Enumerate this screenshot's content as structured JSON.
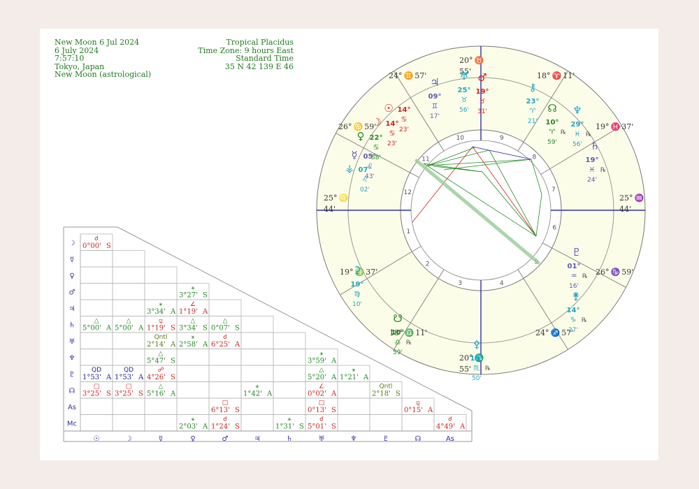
{
  "header": {
    "left": [
      "New Moon 6 Jul 2024",
      "6 July 2024",
      "7:57:10",
      "Tokyo, Japan",
      "New Moon (astrological)"
    ],
    "right": [
      "Tropical Placidus",
      "Time Zone: 9 hours East",
      "Standard Time",
      "35 N 42    139 E 46"
    ]
  },
  "colors": {
    "paper": "#ffffff",
    "background": "#f3ece8",
    "wheel_fill": "#fcfde9",
    "fire": "#d42020",
    "earth": "#208a20",
    "air": "#5a5ab8",
    "water": "#18a8c8",
    "aspect_red": "#cc2222",
    "aspect_green": "#208a20",
    "aspect_blue": "#2020a0",
    "axis_blue": "#3030a0"
  },
  "wheel": {
    "cusps": [
      {
        "house": 1,
        "deg": "25°",
        "sign": "♌",
        "min": "44'"
      },
      {
        "house": 2,
        "deg": "19°",
        "sign": "♍",
        "min": "37'"
      },
      {
        "house": 3,
        "deg": "18°",
        "sign": "♎",
        "min": "11'"
      },
      {
        "house": 4,
        "deg": "20°",
        "sign": "♏",
        "min": "55'"
      },
      {
        "house": 5,
        "deg": "24°",
        "sign": "♐",
        "min": "57'"
      },
      {
        "house": 6,
        "deg": "26°",
        "sign": "♑",
        "min": "59'"
      },
      {
        "house": 7,
        "deg": "25°",
        "sign": "♒",
        "min": "44'"
      },
      {
        "house": 8,
        "deg": "19°",
        "sign": "♓",
        "min": "37'"
      },
      {
        "house": 9,
        "deg": "18°",
        "sign": "♈",
        "min": "11'"
      },
      {
        "house": 10,
        "deg": "20°",
        "sign": "♉",
        "min": "55'"
      },
      {
        "house": 11,
        "deg": "24°",
        "sign": "♊",
        "min": "57'"
      },
      {
        "house": 12,
        "deg": "26°",
        "sign": "♋",
        "min": "59'"
      }
    ],
    "house_numbers": [
      "1",
      "2",
      "3",
      "4",
      "5",
      "6",
      "7",
      "8",
      "9",
      "10",
      "11",
      "12"
    ],
    "planets": [
      {
        "name": "Sun",
        "glyph": "☉",
        "deg": "14°",
        "sign": "♋",
        "min": "23'",
        "retro": "",
        "element": "fire"
      },
      {
        "name": "Moon",
        "glyph": "☽",
        "deg": "14°",
        "sign": "♋",
        "min": "23'",
        "retro": "",
        "element": "fire"
      },
      {
        "name": "Venus",
        "glyph": "♀",
        "deg": "22°",
        "sign": "♋",
        "min": "58'",
        "retro": "",
        "element": "earth"
      },
      {
        "name": "Mercury",
        "glyph": "☿",
        "deg": "05°",
        "sign": "♌",
        "min": "43'",
        "retro": "",
        "element": "air"
      },
      {
        "name": "Chiron",
        "glyph": "⚶",
        "deg": "07°",
        "sign": "♌",
        "min": "02'",
        "retro": "",
        "element": "water"
      },
      {
        "name": "Jupiter",
        "glyph": "♃",
        "deg": "09°",
        "sign": "♊",
        "min": "17'",
        "retro": "",
        "element": "air"
      },
      {
        "name": "Uranus",
        "glyph": "♅",
        "deg": "25°",
        "sign": "♉",
        "min": "56'",
        "retro": "",
        "element": "water"
      },
      {
        "name": "Mars",
        "glyph": "♂",
        "deg": "19°",
        "sign": "♉",
        "min": "31'",
        "retro": "",
        "element": "fire"
      },
      {
        "name": "Eris",
        "glyph": "⚷",
        "deg": "23°",
        "sign": "♈",
        "min": "21'",
        "retro": "",
        "element": "water"
      },
      {
        "name": "North Node",
        "glyph": "☊",
        "deg": "10°",
        "sign": "♈",
        "min": "59'",
        "retro": "℞",
        "element": "earth"
      },
      {
        "name": "Neptune",
        "glyph": "♆",
        "deg": "29°",
        "sign": "♓",
        "min": "56'",
        "retro": "℞",
        "element": "water"
      },
      {
        "name": "Saturn",
        "glyph": "♄",
        "deg": "19°",
        "sign": "♓",
        "min": "24'",
        "retro": "℞",
        "element": "air"
      },
      {
        "name": "Pluto",
        "glyph": "♇",
        "deg": "01°",
        "sign": "♒",
        "min": "16'",
        "retro": "℞",
        "element": "air"
      },
      {
        "name": "Juno",
        "glyph": "⚵",
        "deg": "14°",
        "sign": "♑",
        "min": "27'",
        "retro": "℞",
        "element": "water"
      },
      {
        "name": "Ceres",
        "glyph": "⚳",
        "deg": "19°",
        "sign": "♍",
        "min": "10'",
        "retro": "",
        "element": "water"
      },
      {
        "name": "South Node",
        "glyph": "☋",
        "deg": "10°",
        "sign": "♎",
        "min": "59'",
        "retro": "℞",
        "element": "earth"
      },
      {
        "name": "Pallas",
        "glyph": "⚴",
        "deg": "19°",
        "sign": "♏",
        "min": "50'",
        "retro": "℞",
        "element": "water"
      }
    ]
  },
  "grid": {
    "row_glyphs": [
      "☽",
      "☿",
      "♀",
      "♂",
      "♃",
      "♄",
      "♅",
      "♆",
      "♇",
      "☊",
      "As",
      "Mc"
    ],
    "col_glyphs": [
      "☉",
      "☽",
      "☿",
      "♀",
      "♂",
      "♃",
      "♄",
      "♅",
      "♆",
      "♇",
      "☊",
      "As"
    ],
    "cells": [
      {
        "row": 0,
        "col": 0,
        "sym": "☌",
        "val": "0°00'",
        "ap": "S",
        "color": "red"
      },
      {
        "row": 3,
        "col": 3,
        "sym": "⚹",
        "val": "3°27'",
        "ap": "S",
        "color": "green"
      },
      {
        "row": 4,
        "col": 2,
        "sym": "⚹",
        "val": "3°34'",
        "ap": "A",
        "color": "green"
      },
      {
        "row": 4,
        "col": 3,
        "sym": "∠",
        "val": "1°19'",
        "ap": "A",
        "color": "red"
      },
      {
        "row": 5,
        "col": 0,
        "sym": "△",
        "val": "5°00'",
        "ap": "A",
        "color": "green"
      },
      {
        "row": 5,
        "col": 1,
        "sym": "△",
        "val": "5°00'",
        "ap": "A",
        "color": "green"
      },
      {
        "row": 5,
        "col": 2,
        "sym": "⚼",
        "val": "1°19'",
        "ap": "S",
        "color": "red"
      },
      {
        "row": 5,
        "col": 3,
        "sym": "△",
        "val": "3°34'",
        "ap": "S",
        "color": "green"
      },
      {
        "row": 5,
        "col": 4,
        "sym": "△",
        "val": "0°07'",
        "ap": "S",
        "color": "green"
      },
      {
        "row": 6,
        "col": 2,
        "sym": "Qntl",
        "val": "2°14'",
        "ap": "A",
        "color": "olive"
      },
      {
        "row": 6,
        "col": 3,
        "sym": "⚹",
        "val": "2°58'",
        "ap": "A",
        "color": "green"
      },
      {
        "row": 6,
        "col": 4,
        "sym": "☌",
        "val": "6°25'",
        "ap": "A",
        "color": "red"
      },
      {
        "row": 7,
        "col": 2,
        "sym": "△",
        "val": "5°47'",
        "ap": "S",
        "color": "green"
      },
      {
        "row": 7,
        "col": 7,
        "sym": "⚹",
        "val": "3°59'",
        "ap": "A",
        "color": "green"
      },
      {
        "row": 8,
        "col": 0,
        "sym": "QD",
        "val": "1°53'",
        "ap": "A",
        "color": "blue"
      },
      {
        "row": 8,
        "col": 1,
        "sym": "QD",
        "val": "1°53'",
        "ap": "A",
        "color": "blue"
      },
      {
        "row": 8,
        "col": 2,
        "sym": "☍",
        "val": "4°26'",
        "ap": "S",
        "color": "red"
      },
      {
        "row": 8,
        "col": 7,
        "sym": "△",
        "val": "5°20'",
        "ap": "A",
        "color": "green"
      },
      {
        "row": 8,
        "col": 8,
        "sym": "⚹",
        "val": "1°21'",
        "ap": "A",
        "color": "green"
      },
      {
        "row": 9,
        "col": 0,
        "sym": "□",
        "val": "3°25'",
        "ap": "S",
        "color": "red"
      },
      {
        "row": 9,
        "col": 1,
        "sym": "□",
        "val": "3°25'",
        "ap": "S",
        "color": "red"
      },
      {
        "row": 9,
        "col": 2,
        "sym": "△",
        "val": "5°16'",
        "ap": "A",
        "color": "green"
      },
      {
        "row": 9,
        "col": 5,
        "sym": "⚹",
        "val": "1°42'",
        "ap": "A",
        "color": "green"
      },
      {
        "row": 9,
        "col": 7,
        "sym": "∠",
        "val": "0°02'",
        "ap": "A",
        "color": "red"
      },
      {
        "row": 9,
        "col": 9,
        "sym": "Qntl",
        "val": "2°18'",
        "ap": "S",
        "color": "olive"
      },
      {
        "row": 10,
        "col": 4,
        "sym": "□",
        "val": "6°13'",
        "ap": "S",
        "color": "red"
      },
      {
        "row": 10,
        "col": 7,
        "sym": "□",
        "val": "0°13'",
        "ap": "S",
        "color": "red"
      },
      {
        "row": 10,
        "col": 10,
        "sym": "⚼",
        "val": "0°15'",
        "ap": "A",
        "color": "red"
      },
      {
        "row": 11,
        "col": 3,
        "sym": "⚹",
        "val": "2°03'",
        "ap": "A",
        "color": "green"
      },
      {
        "row": 11,
        "col": 4,
        "sym": "☌",
        "val": "1°24'",
        "ap": "S",
        "color": "red"
      },
      {
        "row": 11,
        "col": 6,
        "sym": "⚹",
        "val": "1°31'",
        "ap": "S",
        "color": "green"
      },
      {
        "row": 11,
        "col": 7,
        "sym": "☌",
        "val": "5°01'",
        "ap": "S",
        "color": "red"
      },
      {
        "row": 11,
        "col": 11,
        "sym": "☌",
        "val": "4°49'",
        "ap": "A",
        "color": "red"
      }
    ]
  }
}
